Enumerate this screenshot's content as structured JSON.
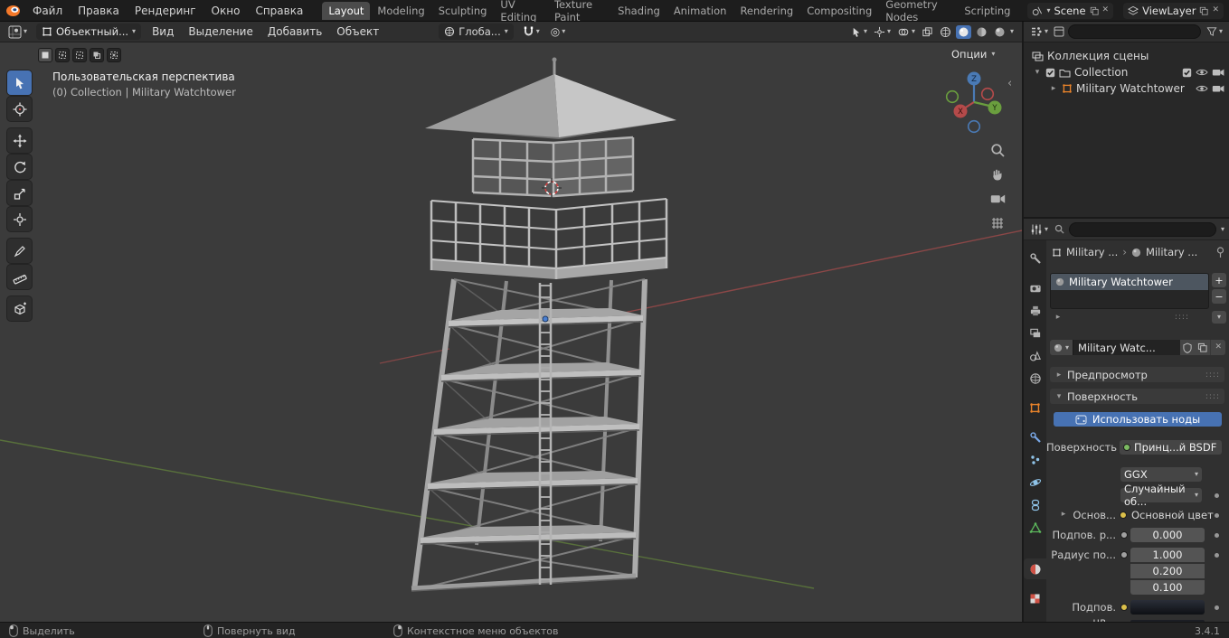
{
  "colors": {
    "accent": "#4772b3",
    "object_orange": "#e8832a",
    "axis_x": "#b54a4a",
    "axis_y": "#6a9e3e",
    "axis_z": "#4a7ab5"
  },
  "icons": {
    "chevron": "▾",
    "tri_right": "▸",
    "tri_down": "▾",
    "close": "✕",
    "plus": "+",
    "minus": "−",
    "breadcrumb_sep": "›",
    "proportional": "◎",
    "collapse": "‹",
    "grip": "::::"
  },
  "topbar": {
    "menus": [
      "Файл",
      "Правка",
      "Рендеринг",
      "Окно",
      "Справка"
    ],
    "workspaces": [
      "Layout",
      "Modeling",
      "Sculpting",
      "UV Editing",
      "Texture Paint",
      "Shading",
      "Animation",
      "Rendering",
      "Compositing",
      "Geometry Nodes",
      "Scripting"
    ],
    "scene_label": "Scene",
    "viewlayer_label": "ViewLayer"
  },
  "viewport_header": {
    "mode": "Объектный...",
    "menus": [
      "Вид",
      "Выделение",
      "Добавить",
      "Объект"
    ],
    "orientation": "Глоба...",
    "options_label": "Опции"
  },
  "viewport": {
    "view_label": "Пользовательская перспектива",
    "context_label": "(0) Collection | Military Watchtower",
    "axis_x": "X",
    "axis_y": "Y",
    "axis_z": "Z"
  },
  "outliner": {
    "scene_collection": "Коллекция сцены",
    "collection": "Collection",
    "object": "Military Watchtower"
  },
  "properties": {
    "breadcrumb_object": "Military ...",
    "breadcrumb_material": "Military ...",
    "slot_name": "Military Watchtower",
    "material_name": "Military Watc...",
    "preview_panel": "Предпросмотр",
    "surface_panel": "Поверхность",
    "use_nodes": "Использовать ноды",
    "surface_label": "Поверхность",
    "surface_value": "Принц...й BSDF",
    "distribution": "GGX",
    "subsurface_method": "Случайный об...",
    "base_section": "Основ...",
    "base_color": "Основной цвет",
    "subsurface_label": "Подпов. р...",
    "subsurface_value": "0.000",
    "radius_label": "Радиус по...",
    "radius_values": [
      "1.000",
      "0.200",
      "0.100"
    ],
    "subsurface_color_label": "Подпов. цв..."
  },
  "statusbar": {
    "select": "Выделить",
    "rotate_view": "Повернуть вид",
    "context_menu": "Контекстное меню объектов",
    "version": "3.4.1"
  }
}
